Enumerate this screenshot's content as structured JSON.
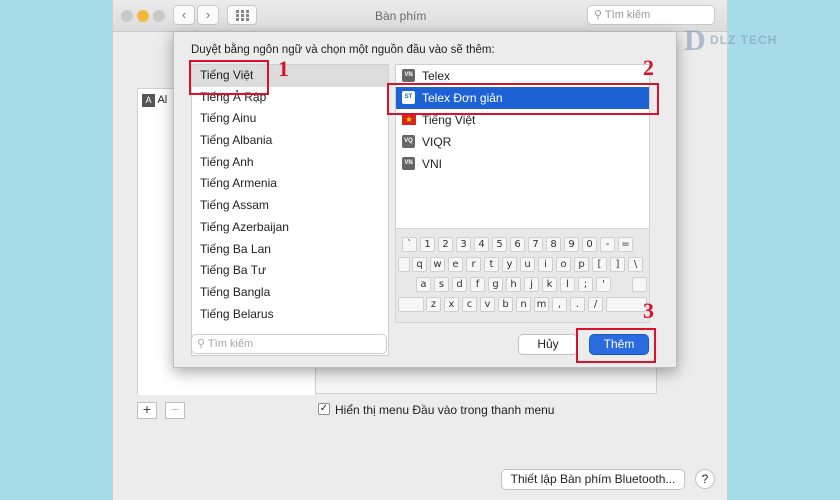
{
  "window": {
    "title": "Bàn phím",
    "search_placeholder": "Tìm kiếm",
    "nav_back": "‹",
    "nav_forward": "›"
  },
  "sheet": {
    "prompt": "Duyệt bằng ngôn ngữ và chọn một nguồn đầu vào sẽ thêm:",
    "languages": [
      "Tiếng Việt",
      "Tiếng Ả Rập",
      "Tiếng Ainu",
      "Tiếng Albania",
      "Tiếng Anh",
      "Tiếng Armenia",
      "Tiếng Assam",
      "Tiếng Azerbaijan",
      "Tiếng Ba Lan",
      "Tiếng Ba Tư",
      "Tiếng Bangla",
      "Tiếng Belarus"
    ],
    "input_sources": [
      {
        "label": "Telex",
        "icon": "telex-icon",
        "badge": "VN"
      },
      {
        "label": "Telex Đơn giản",
        "icon": "telex-simple-icon",
        "badge": "ST"
      },
      {
        "label": "Tiếng Việt",
        "icon": "vietnam-flag-icon",
        "badge": "★"
      },
      {
        "label": "VIQR",
        "icon": "viqr-icon",
        "badge": "VQ"
      },
      {
        "label": "VNI",
        "icon": "vni-icon",
        "badge": "VN"
      }
    ],
    "keyboard_rows": [
      [
        "`",
        "1",
        "2",
        "3",
        "4",
        "5",
        "6",
        "7",
        "8",
        "9",
        "0",
        "-",
        "="
      ],
      [
        "q",
        "w",
        "e",
        "r",
        "t",
        "y",
        "u",
        "i",
        "o",
        "p",
        "[",
        "]",
        "\\"
      ],
      [
        "a",
        "s",
        "d",
        "f",
        "g",
        "h",
        "j",
        "k",
        "l",
        ";",
        "'"
      ],
      [
        "z",
        "x",
        "c",
        "v",
        "b",
        "n",
        "m",
        ",",
        ".",
        "/"
      ]
    ],
    "search_placeholder": "Tìm kiếm",
    "cancel_label": "Hủy",
    "add_label": "Thêm"
  },
  "annotations": {
    "step1": "1",
    "step2": "2",
    "step3": "3",
    "color": "#d9122c"
  },
  "background": {
    "panel_item_letter": "A",
    "panel_item_label": "Al",
    "add_button": "+",
    "remove_button": "−",
    "checkbox_mark": "✓",
    "show_menu_label": "Hiển thị menu Đầu vào trong thanh menu",
    "bluetooth_button": "Thiết lập Bàn phím Bluetooth...",
    "help_button": "?"
  },
  "watermark": {
    "letter": "D",
    "text": "DLZ TECH"
  },
  "colors": {
    "page_bg": "#a6dbe8",
    "selection": "#1d62d4",
    "primary_button": "#2a6be0"
  }
}
